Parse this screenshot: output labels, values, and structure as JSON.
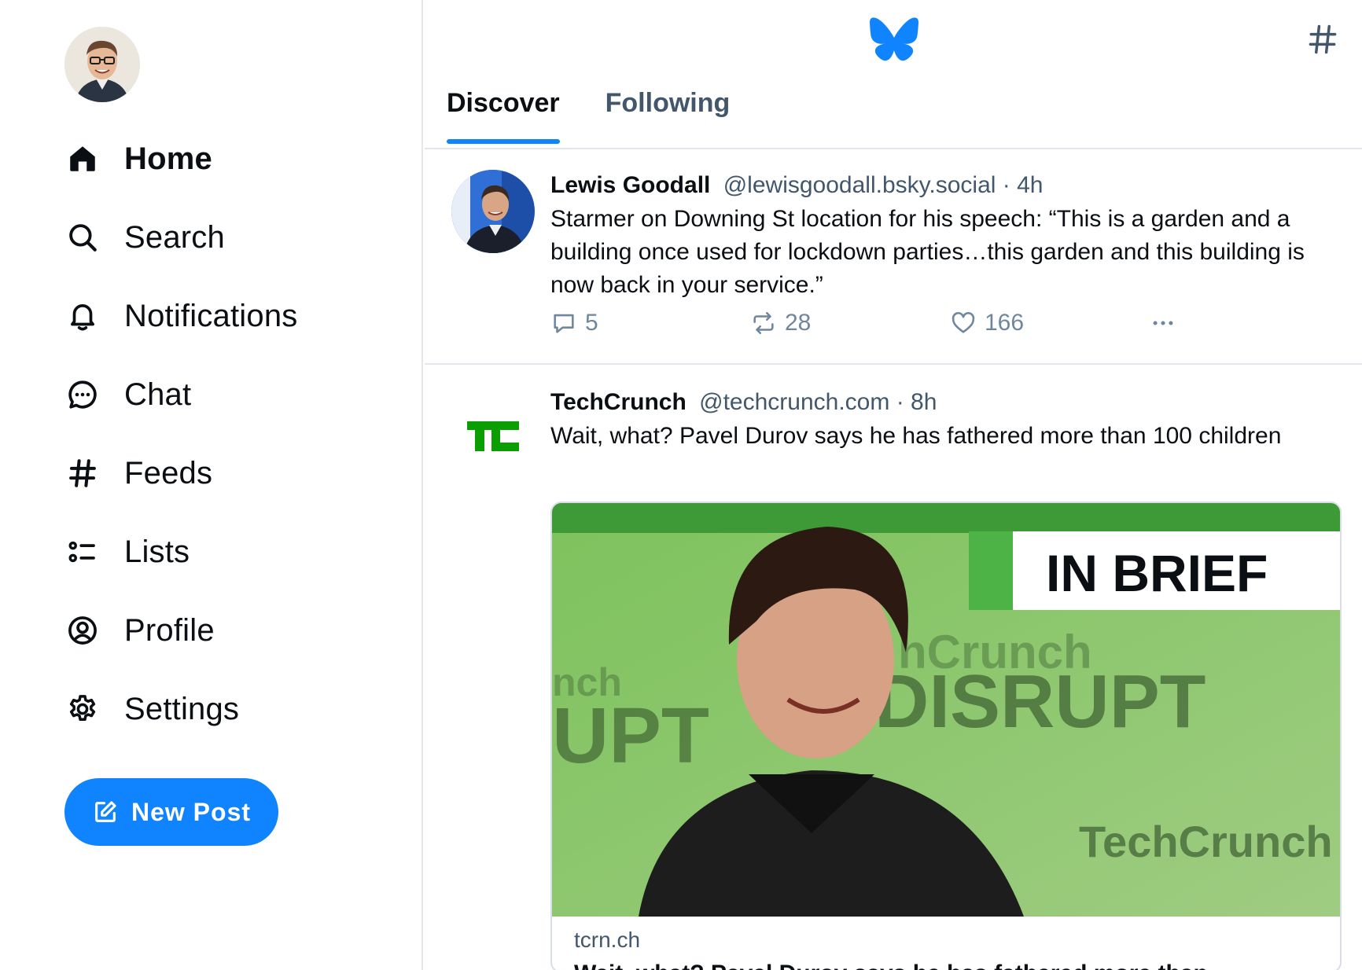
{
  "sidebar": {
    "avatar_alt": "User avatar",
    "nav": [
      {
        "id": "home",
        "label": "Home",
        "icon": "home-icon",
        "active": true
      },
      {
        "id": "search",
        "label": "Search",
        "icon": "search-icon"
      },
      {
        "id": "notifications",
        "label": "Notifications",
        "icon": "bell-icon"
      },
      {
        "id": "chat",
        "label": "Chat",
        "icon": "chat-bubble-icon"
      },
      {
        "id": "feeds",
        "label": "Feeds",
        "icon": "hash-icon"
      },
      {
        "id": "lists",
        "label": "Lists",
        "icon": "list-icon"
      },
      {
        "id": "profile",
        "label": "Profile",
        "icon": "user-circle-icon"
      },
      {
        "id": "settings",
        "label": "Settings",
        "icon": "gear-icon"
      }
    ],
    "new_post_label": "New Post"
  },
  "header": {
    "logo": "butterfly-icon",
    "tabs": [
      {
        "label": "Discover",
        "active": true
      },
      {
        "label": "Following",
        "active": false
      }
    ]
  },
  "posts": [
    {
      "name": "Lewis Goodall",
      "handle": "@lewisgoodall.bsky.social",
      "sep": "·",
      "time": "4h",
      "text": "Starmer on Downing St location for his speech: “This is a garden and a building once used for lockdown parties…this garden and this building is now back in your service.”",
      "replies": "5",
      "reposts": "28",
      "likes": "166"
    },
    {
      "name": "TechCrunch",
      "handle": "@techcrunch.com",
      "sep": "·",
      "time": "8h",
      "text": "Wait, what? Pavel Durov says he has fathered more than 100 children",
      "embed": {
        "banner": "IN BRIEF",
        "bg_text_1": "hCrunch",
        "bg_text_2": "DISRUPT",
        "bg_text_3": "TechCrunch",
        "bg_text_4": "nch",
        "bg_text_5": "UPT",
        "domain": "tcrn.ch",
        "title": "Wait, what? Pavel Durov says he has fathered more than"
      }
    }
  ],
  "colors": {
    "accent": "#1083fe",
    "text": "#0b0f14",
    "muted": "#42576c",
    "border": "#e3e7ec",
    "tc_green": "#0a9e01"
  }
}
